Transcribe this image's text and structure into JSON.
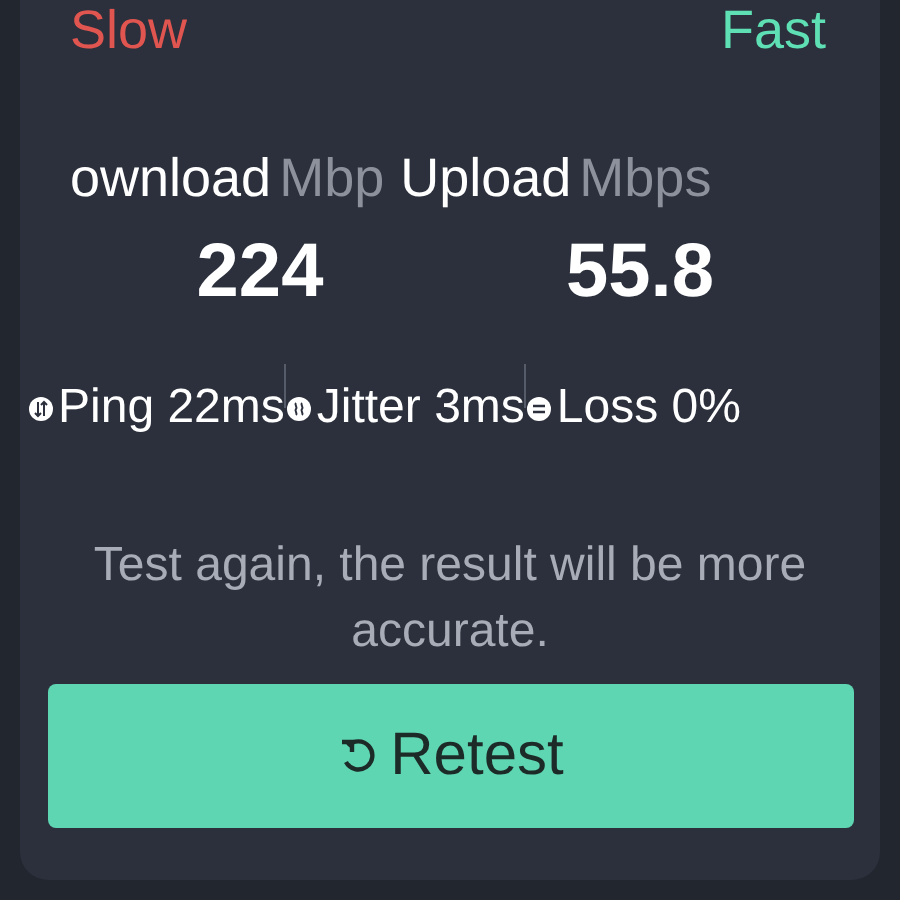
{
  "scale": {
    "min_label": "Slow",
    "max_label": "Fast"
  },
  "results": [
    {
      "label": "ownload",
      "unit": "Mbp",
      "value": "224"
    },
    {
      "label": "Upload",
      "unit": "Mbps",
      "value": "55.8"
    }
  ],
  "metrics": [
    {
      "kind": "ping",
      "text": "Ping 22ms"
    },
    {
      "kind": "jitter",
      "text": "Jitter 3ms"
    },
    {
      "kind": "loss",
      "text": "Loss 0%"
    }
  ],
  "hint": "Test again, the result will be more accurate.",
  "retest_button": {
    "label": "Retest"
  }
}
